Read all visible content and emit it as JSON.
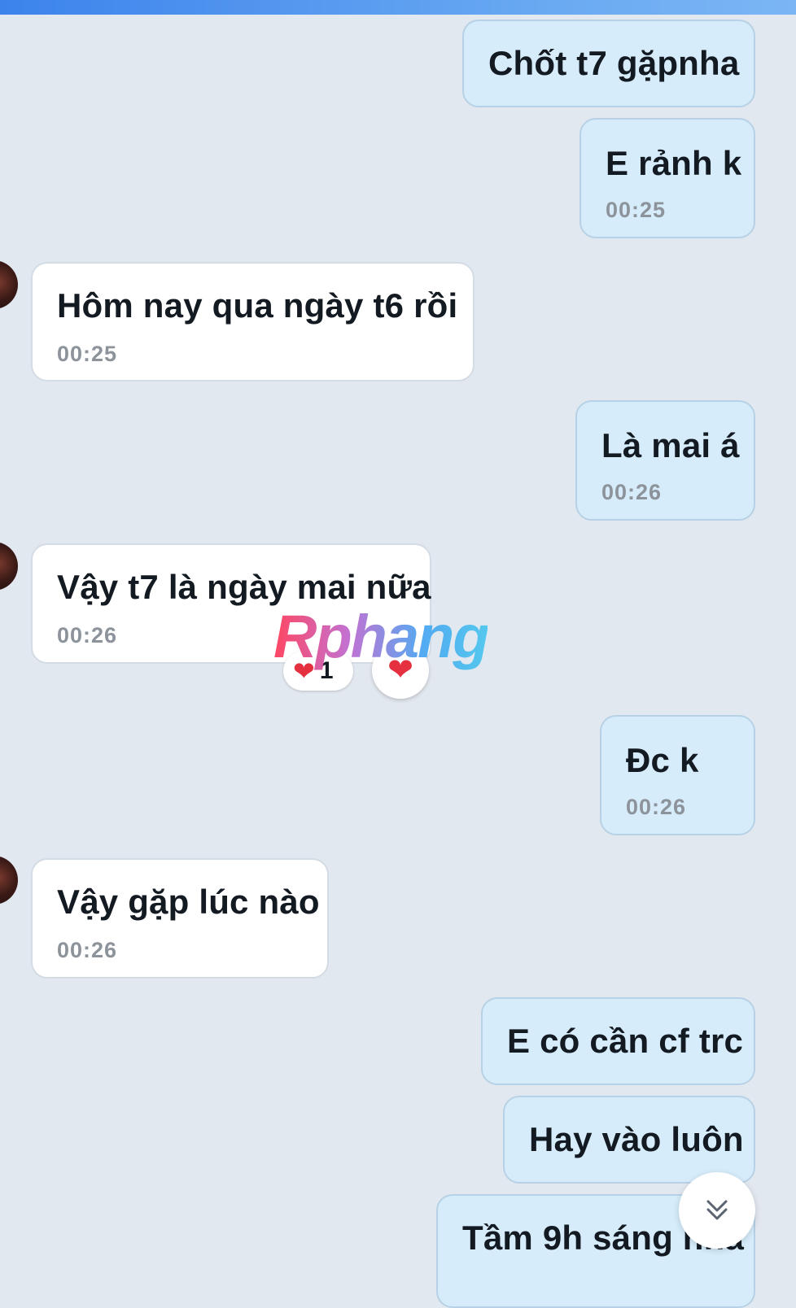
{
  "colors": {
    "mine_bubble": "#d6ecfa",
    "theirs_bubble": "#ffffff",
    "background": "#e2e8ef",
    "heart": "#e4303f"
  },
  "messages": [
    {
      "sender": "me",
      "text": "Chốt t7 gặpnha"
    },
    {
      "sender": "me",
      "text": "E rảnh k",
      "time": "00:25"
    },
    {
      "sender": "them",
      "text": "Hôm nay qua ngày t6 rồi",
      "time": "00:25"
    },
    {
      "sender": "me",
      "text": "Là mai á",
      "time": "00:26"
    },
    {
      "sender": "them",
      "text": "Vậy t7 là ngày mai nữa",
      "time": "00:26"
    },
    {
      "sender": "me",
      "text": "Đc k",
      "time": "00:26"
    },
    {
      "sender": "them",
      "text": "Vậy gặp lúc nào",
      "time": "00:26"
    },
    {
      "sender": "me",
      "text": "E có cần cf trc"
    },
    {
      "sender": "me",
      "text": "Hay vào luôn"
    },
    {
      "sender": "me",
      "text": "Tầm 9h sáng nha"
    }
  ],
  "reaction": {
    "icon": "heart-icon",
    "count": "1"
  },
  "react_button_icon": "heart-icon",
  "watermark": "Rphang",
  "scroll_button_icon": "double-chevron-down-icon"
}
